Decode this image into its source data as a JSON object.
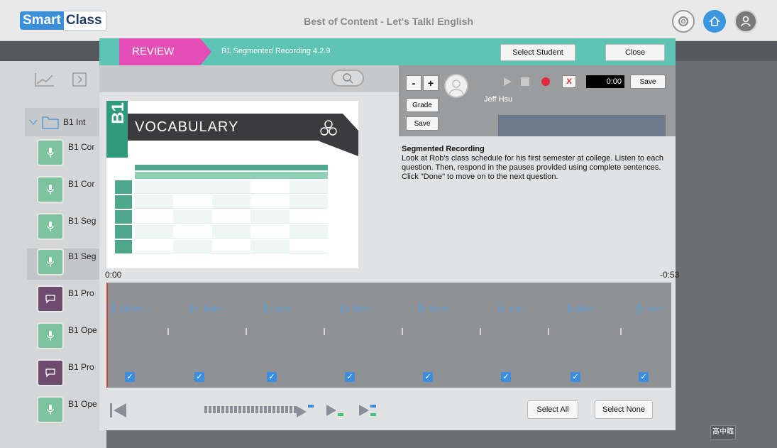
{
  "app": {
    "logo_smart": "Smart",
    "logo_class": "Class",
    "title": "Best of Content - Let's Talk! English",
    "lang_button": "高中職"
  },
  "sidebar": {
    "root_label": "B1 Int",
    "items": [
      {
        "label": "B1 Cor",
        "tile": "green",
        "icon": "microphone-icon"
      },
      {
        "label": "B1 Cor",
        "tile": "green",
        "icon": "microphone-icon"
      },
      {
        "label": "B1 Seg",
        "tile": "green",
        "icon": "microphone-icon"
      },
      {
        "label": "B1 Seg",
        "tile": "green",
        "icon": "microphone-icon"
      },
      {
        "label": "B1 Pro",
        "tile": "purple",
        "icon": "chat-bubble-icon"
      },
      {
        "label": "B1 Ope",
        "tile": "green",
        "icon": "microphone-icon"
      },
      {
        "label": "B1 Pro",
        "tile": "purple",
        "icon": "chat-bubble-icon"
      },
      {
        "label": "B1 Ope",
        "tile": "green",
        "icon": "microphone-icon"
      }
    ]
  },
  "modal": {
    "review_label": "REVIEW",
    "recording_title": "B1 Segmented Recording 4.2.9",
    "select_student_label": "Select Student",
    "close_label": "Close"
  },
  "preview": {
    "vocab_b1": "B1",
    "vocab_title": "VOCABULARY",
    "time_start": "0:00",
    "time_end": "-0:53"
  },
  "recorder": {
    "minus_label": "-",
    "plus_label": "+",
    "grade_label": "Grade",
    "save_left_label": "Save",
    "student_name": "Jeff Hsu",
    "discard_label": "X",
    "timer": "0:00",
    "save_right_label": "Save"
  },
  "instructions": {
    "title": "Segmented Recording",
    "body": "Look at Rob's class schedule for his first semester at college. Listen to each question. Then, respond in the pauses provided using complete sentences. Click \"Done\" to move on to the next question."
  },
  "segments": [
    {
      "checked": true
    },
    {
      "checked": true
    },
    {
      "checked": true
    },
    {
      "checked": true
    },
    {
      "checked": true
    },
    {
      "checked": true
    },
    {
      "checked": true
    },
    {
      "checked": true
    }
  ],
  "bottom": {
    "select_all_label": "Select All",
    "select_none_label": "Select None"
  },
  "colors": {
    "header_teal": "#5ec4b4",
    "review_pink": "#e44fb7",
    "wave_blue": "#4da3e6",
    "checkbox_blue": "#3b8de0"
  }
}
